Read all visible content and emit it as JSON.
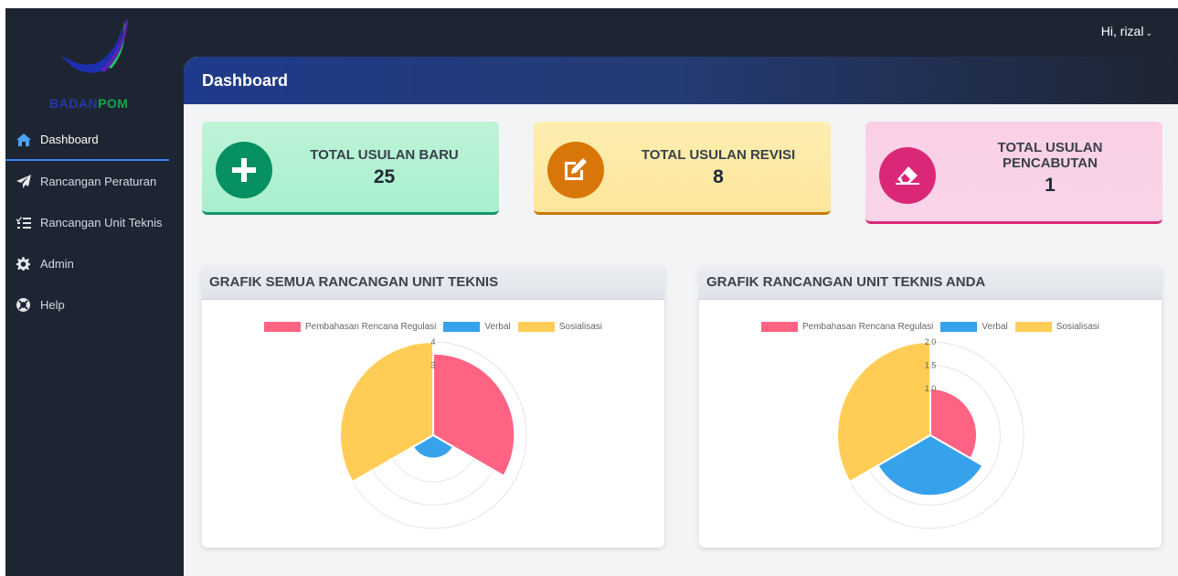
{
  "app": {
    "logo": {
      "word1": "BADAN",
      "word2": "POM"
    },
    "user_greeting": "Hi, rizal"
  },
  "sidebar": {
    "items": [
      {
        "label": "Dashboard",
        "icon": "home-icon",
        "active": true
      },
      {
        "label": "Rancangan Peraturan",
        "icon": "paper-plane-icon"
      },
      {
        "label": "Rancangan Unit Teknis",
        "icon": "tasks-icon"
      },
      {
        "label": "Admin",
        "icon": "gear-icon"
      },
      {
        "label": "Help",
        "icon": "life-ring-icon"
      }
    ]
  },
  "header": {
    "title": "Dashboard"
  },
  "cards": [
    {
      "title": "TOTAL USULAN BARU",
      "value": "25",
      "icon": "plus-icon",
      "color": "#079062"
    },
    {
      "title": "TOTAL USULAN REVISI",
      "value": "8",
      "icon": "edit-icon",
      "color": "#d9760a"
    },
    {
      "title": "TOTAL USULAN PENCABUTAN",
      "value": "1",
      "icon": "eraser-icon",
      "color": "#db2777"
    }
  ],
  "chart_data": [
    {
      "type": "polarArea",
      "title": "GRAFIK SEMUA RANCANGAN UNIT TEKNIS",
      "categories": [
        "Pembahasan Rencana Regulasi",
        "Verbal",
        "Sosialisasi"
      ],
      "values": [
        3.5,
        1,
        4
      ],
      "colors": [
        "#ff6384",
        "#36a2eb",
        "#ffcd56"
      ],
      "rmax": 4,
      "ticks": [
        "4",
        "3"
      ],
      "legend": "top"
    },
    {
      "type": "polarArea",
      "title": "GRAFIK RANCANGAN UNIT TEKNIS ANDA",
      "categories": [
        "Pembahasan Rencana Regulasi",
        "Verbal",
        "Sosialisasi"
      ],
      "values": [
        1,
        1.3,
        2
      ],
      "colors": [
        "#ff6384",
        "#36a2eb",
        "#ffcd56"
      ],
      "rmax": 2,
      "ticks": [
        "2.0",
        "1.5",
        "1.0"
      ],
      "legend": "top"
    }
  ]
}
